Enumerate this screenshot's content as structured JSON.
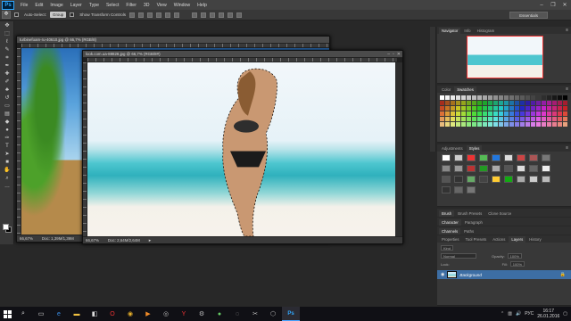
{
  "app": {
    "logo": "Ps",
    "menus": [
      "File",
      "Edit",
      "Image",
      "Layer",
      "Type",
      "Select",
      "Filter",
      "3D",
      "View",
      "Window",
      "Help"
    ]
  },
  "options_bar": {
    "auto_select_label": "Auto-Select:",
    "auto_select_value": "Group",
    "show_transform_label": "Show Transform Controls",
    "workspace": "Essentials"
  },
  "doc_back": {
    "title": "turbinefoam-ru-40610.jpg @ 66,7% (RGB/8)",
    "zoom": "66,67%",
    "doc_size": "Doc: 1,39M/1,39M"
  },
  "doc_front": {
    "title": "look.com.ua-88828.jpg @ 66,7% (RGB/8#)",
    "zoom": "66,67%",
    "doc_size": "Doc: 2,64M/2,64M"
  },
  "panels": {
    "navigator_tabs": [
      "Navigator",
      "Info",
      "Histogram"
    ],
    "color_tabs": [
      "Color",
      "Swatches"
    ],
    "adjust_tabs": [
      "Adjustments",
      "Styles"
    ],
    "brush_tabs": [
      "Brush",
      "Brush Presets",
      "Clone Source"
    ],
    "character_tabs": [
      "Character",
      "Paragraph"
    ],
    "channels_tabs": [
      "Channels",
      "Paths"
    ],
    "layers_tabs": [
      "Properties",
      "Tool Presets",
      "Actions",
      "Layers",
      "History"
    ],
    "layer_kind": "Kind",
    "blend_mode": "Normal",
    "opacity_label": "Opacity:",
    "opacity_value": "100%",
    "lock_label": "Lock:",
    "fill_label": "Fill:",
    "fill_value": "100%",
    "layers": [
      {
        "name": "Background",
        "selected": true
      }
    ]
  },
  "taskbar": {
    "lang": "РУС",
    "time": "16:17",
    "date": "26.01.2016"
  }
}
